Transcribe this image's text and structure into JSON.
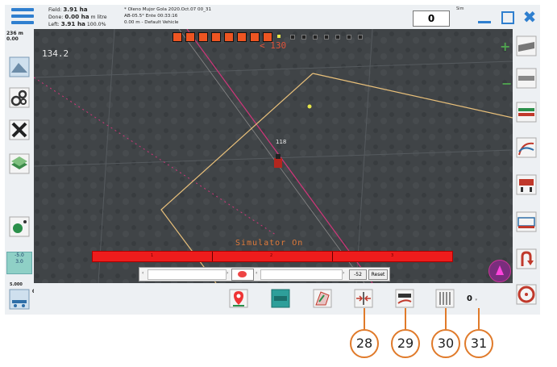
{
  "status": {
    "field_label": "Field:",
    "field_value": "3.91 ha",
    "done_label": "Done:",
    "done_value": "0.00 ha",
    "done_unit": "m litre",
    "left_label": "Left:",
    "left_value": "3.91 ha",
    "left_pct": "100.0%"
  },
  "job": {
    "line1": "* Oleno Mujor Gola 2020.Oct.07 00_31",
    "line2": "AB-05.5° Ente 00:33:16",
    "line3": "0.00 m - Default Vehicle"
  },
  "counter": "0",
  "sim_label": "Sim",
  "left_panel": {
    "scale_top": "236 m",
    "scale_bottom": "0.00",
    "offset_top": "-5.0",
    "offset_bottom": "3.0",
    "offset_sub": "0",
    "small_label": "5.000"
  },
  "map": {
    "heading_left": "134.2",
    "heading_top": "< 130",
    "track_number": "118",
    "simulator_text": "Simulator On",
    "sections": [
      "1",
      "2",
      "3"
    ],
    "slider_value": "-52",
    "reset_label": "Reset",
    "colors": {
      "boundary": "#e9c07a",
      "guide_line": "#d1357a",
      "section": "#ee1c1c",
      "lightbar_on": "#ee5522"
    }
  },
  "bottom": {
    "count_value": "0"
  },
  "callouts": [
    "28",
    "29",
    "30",
    "31"
  ]
}
